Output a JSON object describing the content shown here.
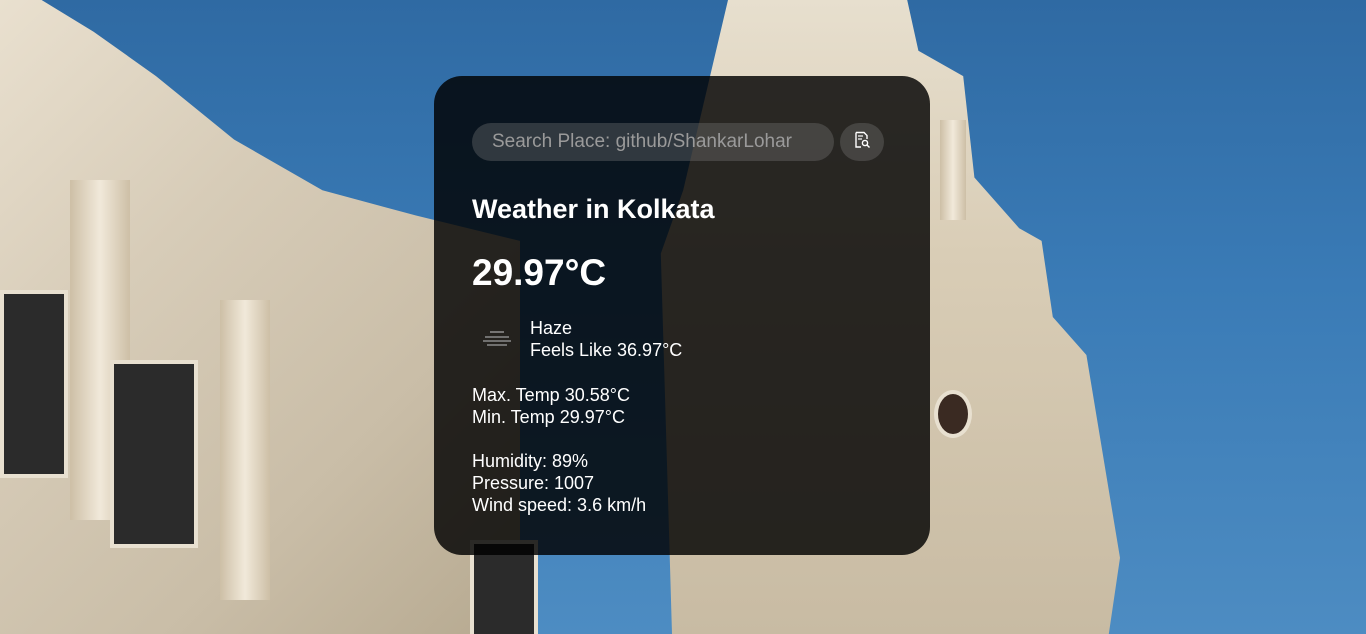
{
  "search": {
    "placeholder": "Search Place: github/ShankarLohar"
  },
  "weather": {
    "title": "Weather in Kolkata",
    "temperature": "29.97°C",
    "condition": "Haze",
    "feels_like": "Feels Like 36.97°C",
    "max_temp": "Max. Temp 30.58°C",
    "min_temp": "Min. Temp 29.97°C",
    "humidity": "Humidity: 89%",
    "pressure": "Pressure: 1007",
    "wind_speed": "Wind speed: 3.6 km/h"
  },
  "icons": {
    "search": "search-document-icon",
    "condition": "haze-icon"
  },
  "colors": {
    "card_bg": "#000000",
    "sky": "#3a7bb6",
    "text": "#ffffff"
  }
}
